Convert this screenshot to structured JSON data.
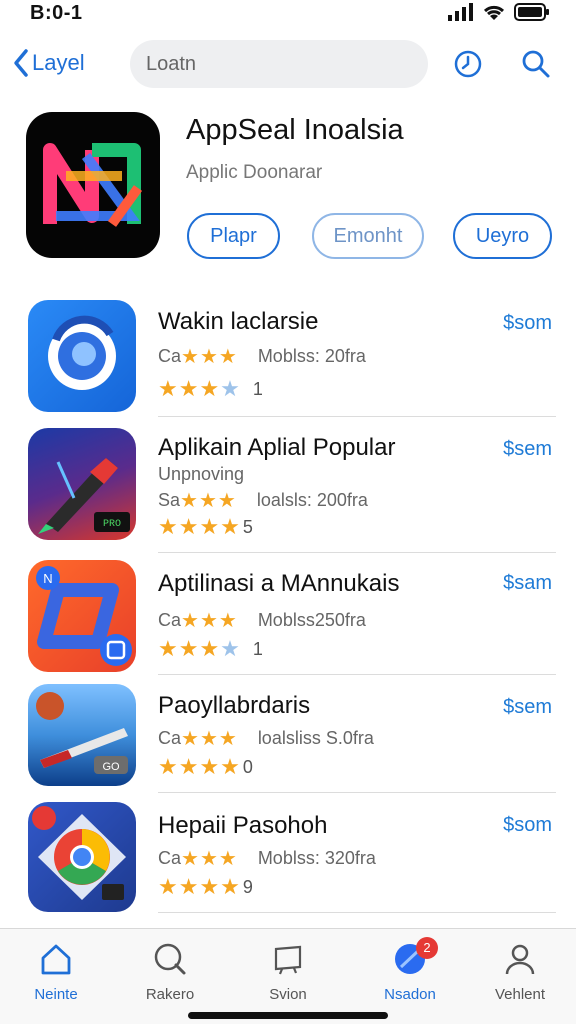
{
  "status_bar": {
    "time": "B:0-1"
  },
  "nav": {
    "back_label": "Layel",
    "search_value": "Loatn"
  },
  "hero": {
    "title": "AppSeal Inoalsia",
    "subtitle": "Applic Doonarar",
    "buttons": [
      "Plapr",
      "Emonht",
      "Ueyro"
    ]
  },
  "apps": [
    {
      "name": "Wakin laclarsie",
      "desc": "",
      "meta_prefix": "Ca",
      "meta_stars": "★★★",
      "meta_text": "Moblss: 20fra",
      "rating_stars": "★★★",
      "rating_empty": "★",
      "rating_value": "1",
      "price": "$som"
    },
    {
      "name": "Aplikain Aplial Popular",
      "desc": "Unpnoving",
      "meta_prefix": "Sa",
      "meta_stars": "★★★",
      "meta_text": "loalsls: 200fra",
      "rating_stars": "★★★★",
      "rating_empty": "",
      "rating_value": "5",
      "price": "$sem"
    },
    {
      "name": "Aptilinasi a MAnnukais",
      "desc": "",
      "meta_prefix": "Ca",
      "meta_stars": "★★★",
      "meta_text": "Moblss250fra",
      "rating_stars": "★★★",
      "rating_empty": "★",
      "rating_value": "1",
      "price": "$sam"
    },
    {
      "name": "Paoyllabrdaris",
      "desc": "",
      "meta_prefix": "Ca",
      "meta_stars": "★★★",
      "meta_text": "loalsliss S.0fra",
      "rating_stars": "★★★★",
      "rating_empty": "",
      "rating_value": "0",
      "price": "$sem"
    },
    {
      "name": "Hepaii Pasohoh",
      "desc": "",
      "meta_prefix": "Ca",
      "meta_stars": "★★★",
      "meta_text": "Moblss: 320fra",
      "rating_stars": "★★★★",
      "rating_empty": "",
      "rating_value": "9",
      "price": "$som"
    }
  ],
  "tabs": [
    {
      "label": "Neinte",
      "icon": "home-icon",
      "active": true
    },
    {
      "label": "Rakero",
      "icon": "search-icon",
      "active": false
    },
    {
      "label": "Svion",
      "icon": "box-icon",
      "active": false
    },
    {
      "label": "Nsadon",
      "icon": "globe-icon",
      "active": true,
      "badge": "2"
    },
    {
      "label": "Vehlent",
      "icon": "person-icon",
      "active": false
    }
  ],
  "colors": {
    "accent": "#1f6fd6",
    "star": "#f5a623",
    "price": "#1f7bd6",
    "badge": "#e53935"
  }
}
